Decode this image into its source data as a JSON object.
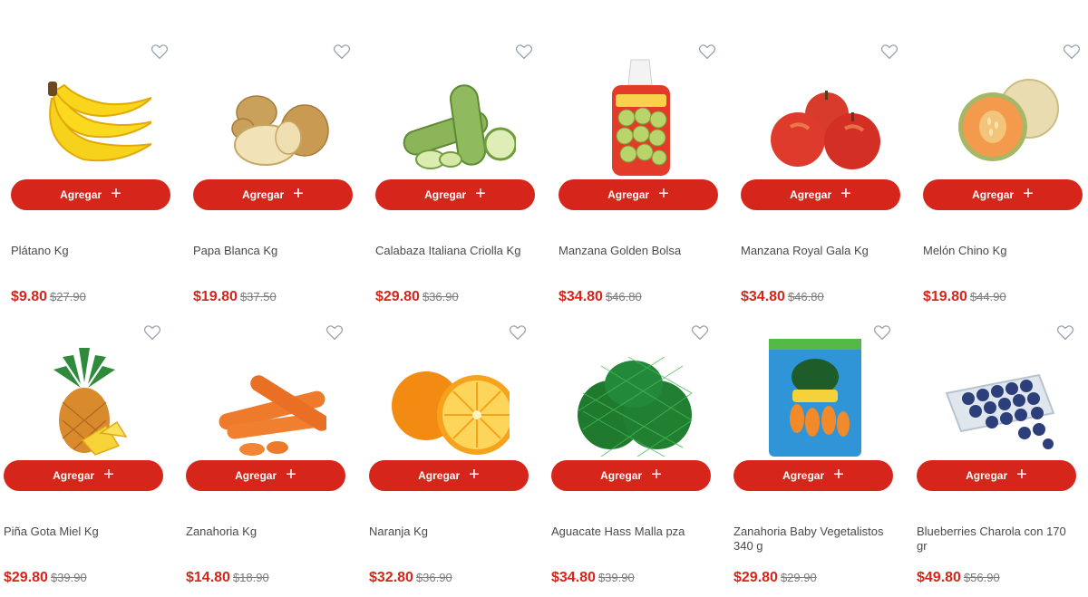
{
  "ui": {
    "add_label": "Agregar",
    "add_icon": "plus-icon",
    "favorite_icon": "heart-outline-icon",
    "accent_color": "#d6261c"
  },
  "products": [
    {
      "name": "Plátano Kg",
      "price": "$9.80",
      "old_price": "$27.90",
      "image": "banana"
    },
    {
      "name": "Papa Blanca Kg",
      "price": "$19.80",
      "old_price": "$37.50",
      "image": "potato"
    },
    {
      "name": "Calabaza Italiana Criolla Kg",
      "price": "$29.80",
      "old_price": "$36.90",
      "image": "zucchini"
    },
    {
      "name": "Manzana Golden Bolsa",
      "price": "$34.80",
      "old_price": "$46.80",
      "image": "apple-bag"
    },
    {
      "name": "Manzana Royal Gala Kg",
      "price": "$34.80",
      "old_price": "$46.80",
      "image": "red-apples"
    },
    {
      "name": "Melón Chino Kg",
      "price": "$19.80",
      "old_price": "$44.90",
      "image": "cantaloupe"
    },
    {
      "name": "Piña Gota Miel Kg",
      "price": "$29.80",
      "old_price": "$39.90",
      "image": "pineapple"
    },
    {
      "name": "Zanahoria Kg",
      "price": "$14.80",
      "old_price": "$18.90",
      "image": "carrots"
    },
    {
      "name": "Naranja Kg",
      "price": "$32.80",
      "old_price": "$36.90",
      "image": "orange"
    },
    {
      "name": "Aguacate Hass Malla pza",
      "price": "$34.80",
      "old_price": "$39.90",
      "image": "avocado-mesh"
    },
    {
      "name": "Zanahoria Baby Vegetalistos 340 g",
      "price": "$29.80",
      "old_price": "$29.90",
      "image": "baby-carrot-bag"
    },
    {
      "name": "Blueberries Charola con 170 gr",
      "price": "$49.80",
      "old_price": "$56.90",
      "image": "blueberries"
    }
  ]
}
